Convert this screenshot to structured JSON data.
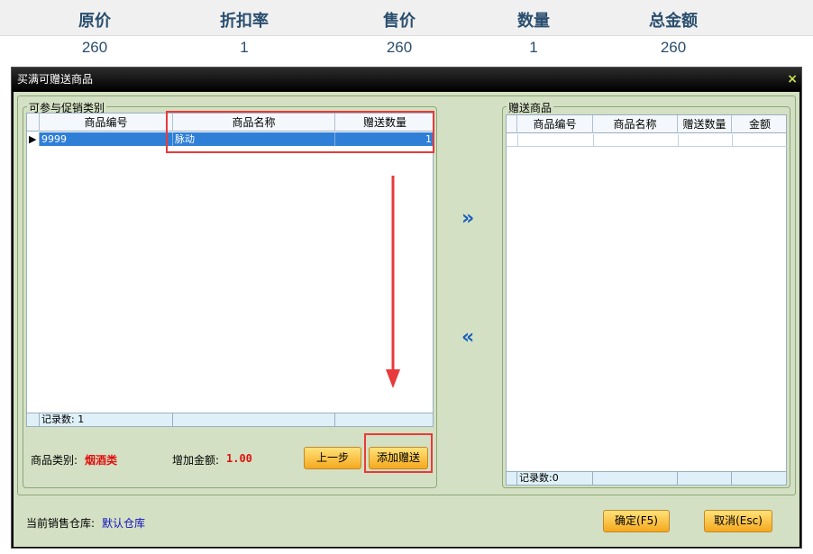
{
  "summary": {
    "headers": [
      "原价",
      "折扣率",
      "售价",
      "数量",
      "总金额"
    ],
    "values": [
      "260",
      "1",
      "260",
      "1",
      "260"
    ]
  },
  "dialog": {
    "title": "买满可赠送商品",
    "close_glyph": "×",
    "left_group": {
      "title": "可参与促销类别",
      "columns": [
        "商品编号",
        "商品名称",
        "赠送数量"
      ],
      "rows": [
        {
          "code": "9999",
          "name": "脉动",
          "qty": "1"
        }
      ],
      "footer": "记录数: 1"
    },
    "category_label": "商品类别:",
    "category_value": "烟酒类",
    "added_amount_label": "增加金额:",
    "added_amount_value": "1.00",
    "prev_button": "上一步",
    "add_gift_button": "添加赠送",
    "move_right": "»",
    "move_left": "«",
    "right_group": {
      "title": "赠送商品",
      "columns": [
        "商品编号",
        "商品名称",
        "赠送数量",
        "金额"
      ],
      "footer": "记录数:0"
    },
    "warehouse_label": "当前销售仓库:",
    "warehouse_value": "默认仓库",
    "ok_button": "确定(F5)",
    "cancel_button": "取消(Esc)"
  },
  "annotation_color": "#e83a3a"
}
